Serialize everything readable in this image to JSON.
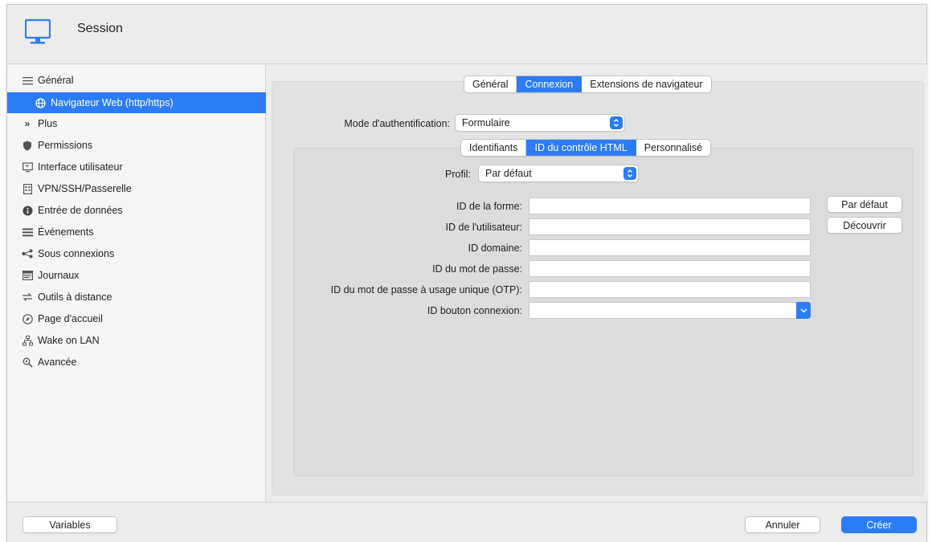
{
  "window": {
    "title": "Session"
  },
  "sidebar": {
    "items": [
      {
        "label": "Général",
        "icon": "menu-lines-icon"
      },
      {
        "label": "Navigateur Web (http/https)",
        "icon": "globe-icon",
        "active": true
      },
      {
        "label": "Plus",
        "icon": "double-chevron-right-icon"
      },
      {
        "label": "Permissions",
        "icon": "shield-icon"
      },
      {
        "label": "Interface utilisateur",
        "icon": "monitor-icon"
      },
      {
        "label": "VPN/SSH/Passerelle",
        "icon": "server-icon"
      },
      {
        "label": "Entrée de données",
        "icon": "info-circle-icon"
      },
      {
        "label": "Événements",
        "icon": "list-lines-icon"
      },
      {
        "label": "Sous connexions",
        "icon": "share-nodes-icon"
      },
      {
        "label": "Journaux",
        "icon": "log-table-icon"
      },
      {
        "label": "Outils à distance",
        "icon": "arrows-exchange-icon"
      },
      {
        "label": "Page d'accueil",
        "icon": "compass-icon"
      },
      {
        "label": "Wake on LAN",
        "icon": "network-icon"
      },
      {
        "label": "Avancée",
        "icon": "magnifier-icon"
      }
    ]
  },
  "tabs": {
    "items": [
      "Général",
      "Connexion",
      "Extensions de navigateur"
    ],
    "selected": "Connexion"
  },
  "auth": {
    "label": "Mode d'authentification:",
    "value": "Formulaire"
  },
  "subtabs": {
    "items": [
      "Identifiants",
      "ID du contrôle HTML",
      "Personnalisé"
    ],
    "selected": "ID du contrôle HTML"
  },
  "profile": {
    "label": "Profil:",
    "value": "Par défaut"
  },
  "form": {
    "fields": [
      {
        "label": "ID de la forme:",
        "value": ""
      },
      {
        "label": "ID de l'utilisateur:",
        "value": ""
      },
      {
        "label": "ID domaine:",
        "value": ""
      },
      {
        "label": "ID du mot de passe:",
        "value": ""
      },
      {
        "label": "ID du mot de passe à usage unique (OTP):",
        "value": ""
      },
      {
        "label": "ID bouton connexion:",
        "value": ""
      }
    ],
    "default_button": "Par défaut",
    "discover_button": "Découvrir"
  },
  "footer": {
    "variables_button": "Variables",
    "cancel_button": "Annuler",
    "create_button": "Créer"
  },
  "colors": {
    "accent": "#2b7cf5",
    "sidebar_bg": "#f5f5f5",
    "window_bg": "#ececec"
  }
}
